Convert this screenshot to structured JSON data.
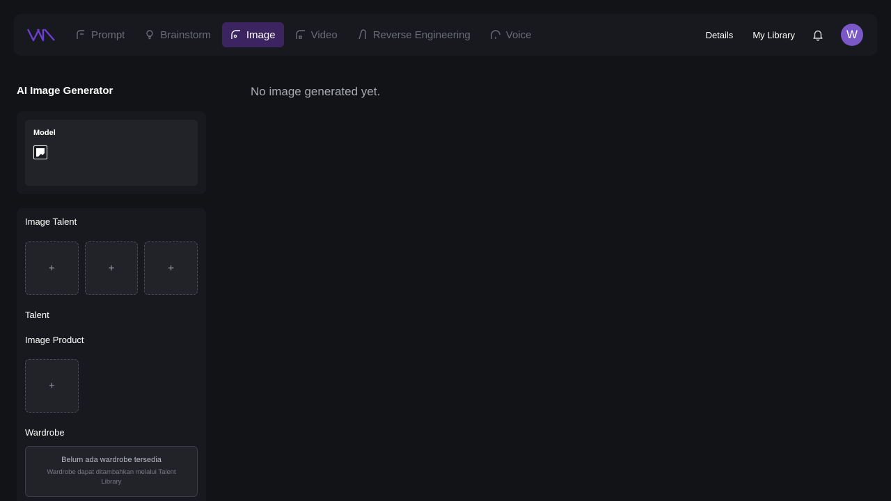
{
  "nav": {
    "items": [
      {
        "label": "Prompt",
        "icon": "prompt-icon",
        "active": false
      },
      {
        "label": "Brainstorm",
        "icon": "bulb-icon",
        "active": false
      },
      {
        "label": "Image",
        "icon": "image-icon",
        "active": true
      },
      {
        "label": "Video",
        "icon": "video-icon",
        "active": false
      },
      {
        "label": "Reverse Engineering",
        "icon": "reverse-icon",
        "active": false
      },
      {
        "label": "Voice",
        "icon": "voice-icon",
        "active": false
      }
    ],
    "details_label": "Details",
    "library_label": "My Library",
    "avatar_initial": "W"
  },
  "sidebar": {
    "title": "AI Image Generator",
    "model_label": "Model",
    "image_talent_label": "Image Talent",
    "talent_slot_symbol": "+",
    "talent_label": "Talent",
    "image_product_label": "Image Product",
    "product_slot_symbol": "+",
    "wardrobe_label": "Wardrobe",
    "wardrobe_empty": "Belum ada wardrobe tersedia",
    "wardrobe_hint": "Wardrobe dapat ditambahkan melalui Talent Library"
  },
  "main": {
    "empty_message": "No image generated yet."
  },
  "colors": {
    "accent": "#3b2460",
    "avatar": "#7b58c8",
    "background": "#121317"
  }
}
